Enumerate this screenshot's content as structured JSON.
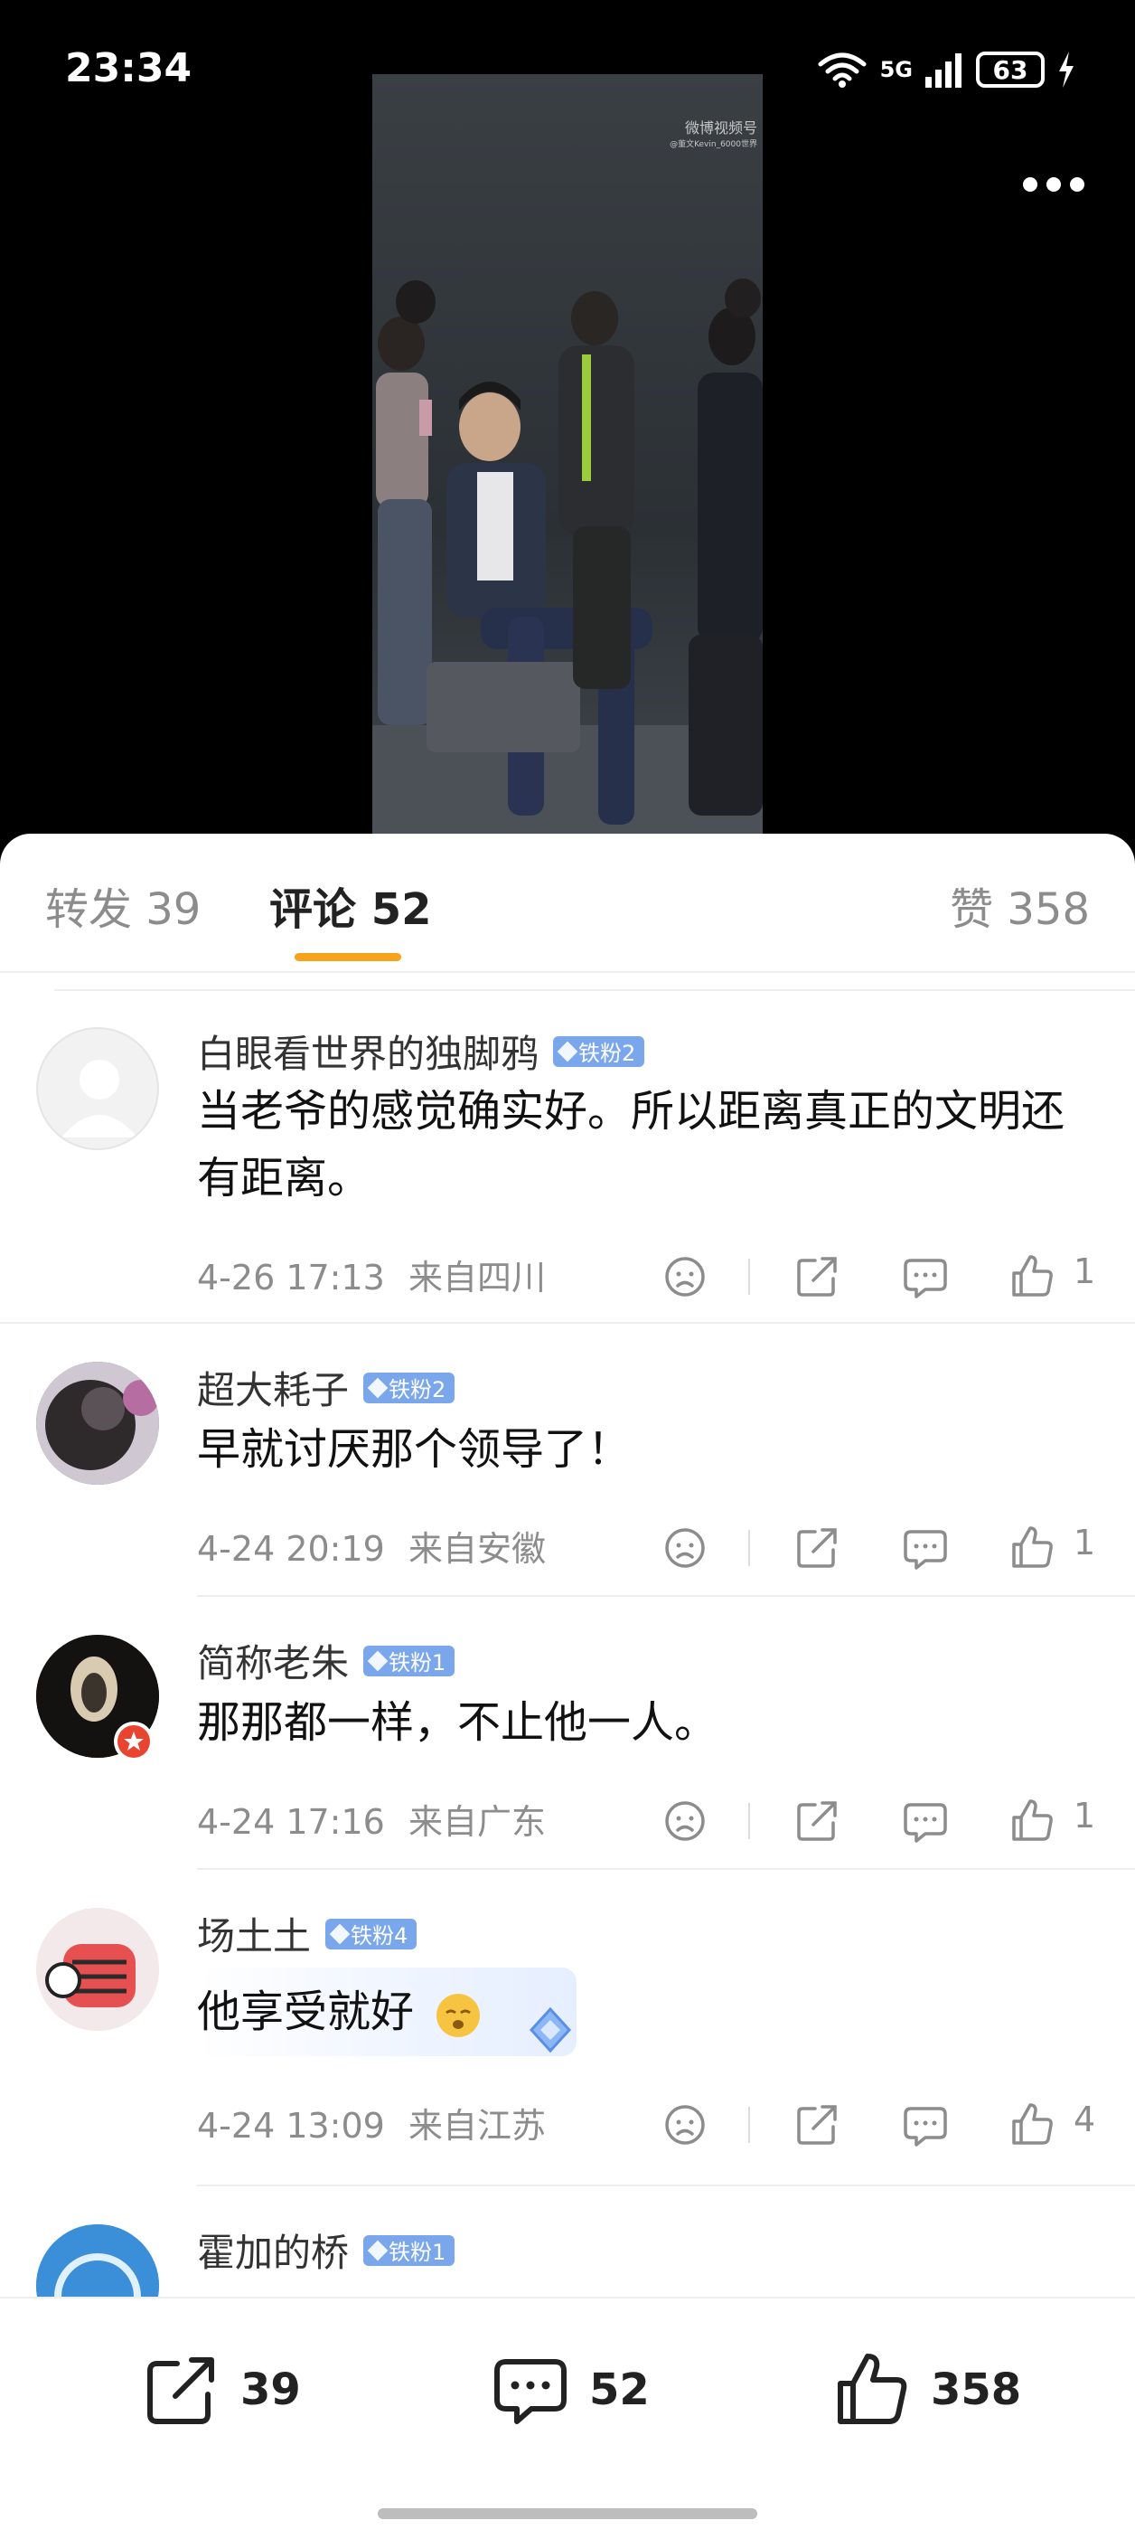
{
  "status_bar": {
    "time": "23:34",
    "network": "5G",
    "battery": "63"
  },
  "video": {
    "watermark": "微博视频号",
    "watermark_sub": "@董文Kevin_6000世界",
    "more_icon": "ellipsis-icon"
  },
  "tabs": {
    "repost_label": "转发 39",
    "comment_label": "评论 52",
    "like_label": "赞 358",
    "accent_color": "#f7a21b"
  },
  "comments": [
    {
      "username": "白眼看世界的独脚鸦",
      "badge": "铁粉2",
      "text": "当老爷的感觉确实好。所以距离真正的文明还有距离。",
      "time": "4-26 17:13",
      "location": "来自四川",
      "likes": "1"
    },
    {
      "username": "超大耗子",
      "badge": "铁粉2",
      "text": "早就讨厌那个领导了！",
      "time": "4-24 20:19",
      "location": "来自安徽",
      "likes": "1"
    },
    {
      "username": "简称老朱",
      "badge": "铁粉1",
      "text": "那那都一样，不止他一人。",
      "time": "4-24 17:16",
      "location": "来自广东",
      "likes": "1"
    },
    {
      "username": "场土土",
      "badge": "铁粉4",
      "text": "他享受就好",
      "time": "4-24 13:09",
      "location": "来自江苏",
      "likes": "4"
    },
    {
      "username": "霍加的桥",
      "badge": "铁粉1"
    }
  ],
  "bottom_bar": {
    "repost_count": "39",
    "comment_count": "52",
    "like_count": "358"
  },
  "colors": {
    "badge_blue": "#7aa7ec",
    "meta_gray": "#8c8c8c"
  }
}
